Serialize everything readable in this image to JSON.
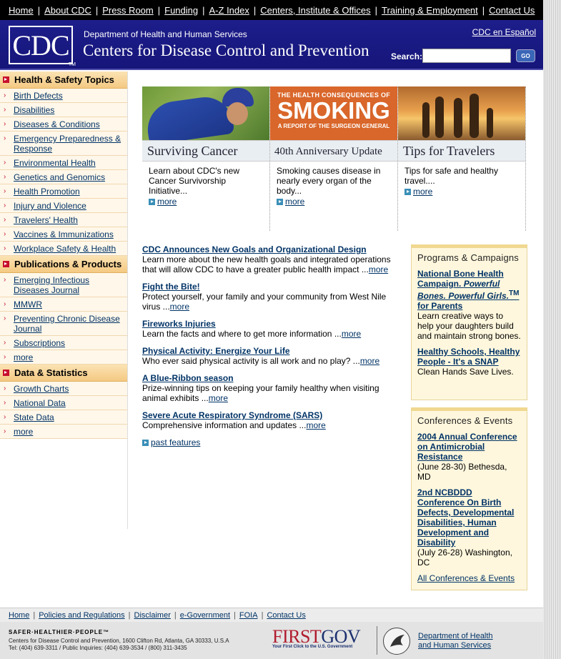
{
  "topnav": [
    "Home",
    "About CDC",
    "Press Room",
    "Funding",
    "A-Z Index",
    "Centers, Institute & Offices",
    "Training & Employment",
    "Contact Us"
  ],
  "header": {
    "logo_text": "CDC",
    "logo_tm": "TM",
    "department": "Department of Health and Human Services",
    "title": "Centers for Disease Control and Prevention",
    "espanol": "CDC en Español",
    "search_label": "Search:",
    "search_value": "",
    "go_label": "GO"
  },
  "sidebar": {
    "health_title": "Health & Safety Topics",
    "health_items": [
      "Birth Defects",
      "Disabilities",
      "Diseases & Conditions",
      "Emergency Preparedness & Response",
      "Environmental Health",
      "Genetics and Genomics",
      "Health Promotion",
      "Injury and Violence",
      "Travelers' Health",
      "Vaccines & Immunizations",
      "Workplace Safety & Health"
    ],
    "pubs_title": "Publications & Products",
    "pubs_items": [
      "Emerging Infectious Diseases Journal",
      "MMWR",
      "Preventing Chronic Disease Journal",
      "Subscriptions",
      "more"
    ],
    "data_title": "Data & Statistics",
    "data_items": [
      "Growth Charts",
      "National Data",
      "State Data",
      "more"
    ]
  },
  "features": [
    {
      "title": "Surviving Cancer",
      "text": "Learn about CDC's new Cancer Survivorship Initiative...",
      "more": "more"
    },
    {
      "title": "40th Anniversary Update",
      "text": "Smoking causes disease in nearly every organ of the body...",
      "more": "more",
      "img_top": "THE HEALTH CONSEQUENCES OF",
      "img_big": "SMOKING",
      "img_bottom": "A REPORT OF THE SURGEON GENERAL"
    },
    {
      "title": "Tips for Travelers",
      "text": "Tips for safe and healthy travel....",
      "more": "more"
    }
  ],
  "news": [
    {
      "title": "CDC Announces New Goals and Organizational Design",
      "text": "Learn more about the new health goals and integrated operations that will allow CDC to have a greater public health impact ...",
      "more": "more"
    },
    {
      "title": "Fight the Bite!",
      "text": "Protect yourself, your family and your community from West Nile virus ...",
      "more": "more"
    },
    {
      "title": "Fireworks Injuries",
      "text": "Learn the facts and where to get more information ...",
      "more": "more"
    },
    {
      "title": "Physical Activity: Energize Your Life",
      "text": "Who ever said physical activity is all work and no play? ...",
      "more": "more"
    },
    {
      "title": "A Blue-Ribbon season",
      "text": "Prize-winning tips on keeping your family healthy when visiting animal exhibits ...",
      "more": "more"
    },
    {
      "title": "Severe Acute Respiratory Syndrome (SARS)",
      "text": "Comprehensive information and updates ...",
      "more": "more"
    }
  ],
  "past_features": "past features",
  "programs": {
    "title": "Programs & Campaigns",
    "item1_a": "National Bone Health Campaign.",
    "item1_b": "Powerful Bones. Powerful Girls.",
    "item1_tm": "TM",
    "item1_c": "for Parents",
    "item1_text": "Learn creative ways to help your daughters build and maintain strong bones.",
    "item2_link": "Healthy Schools, Healthy People - It's a SNAP",
    "item2_text": "Clean Hands Save Lives."
  },
  "conferences": {
    "title": "Conferences & Events",
    "item1_link": "2004 Annual Conference on Antimicrobial Resistance",
    "item1_text": "(June 28-30) Bethesda, MD",
    "item2_link": "2nd NCBDDD Conference On Birth Defects, Developmental Disabilities, Human Development and Disability",
    "item2_text": "(July 26-28) Washington, DC",
    "all_link": "All Conferences & Events"
  },
  "footer": {
    "links": [
      "Home",
      "Policies and Regulations",
      "Disclaimer",
      "e-Government",
      "FOIA",
      "Contact Us"
    ],
    "slogan": "SAFER·HEALTHIER·PEOPLE™",
    "address": "Centers for Disease Control and Prevention, 1600 Clifton Rd, Atlanta, GA 30333, U.S.A",
    "phones": "Tel: (404) 639-3311 / Public Inquiries: (404) 639-3534 / (800) 311-3435",
    "firstgov_first": "FIRST",
    "firstgov_gov": "GOV",
    "firstgov_tag": "Your First Click to the U.S. Government",
    "hhs_link1": "Department of Health",
    "hhs_link2": "and Human Services"
  },
  "colors": {
    "nav_bg": "#000000",
    "header_bg": "#1a1a80",
    "section_head": "#f4c983",
    "accent_red": "#c8102e",
    "link": "#003366"
  }
}
